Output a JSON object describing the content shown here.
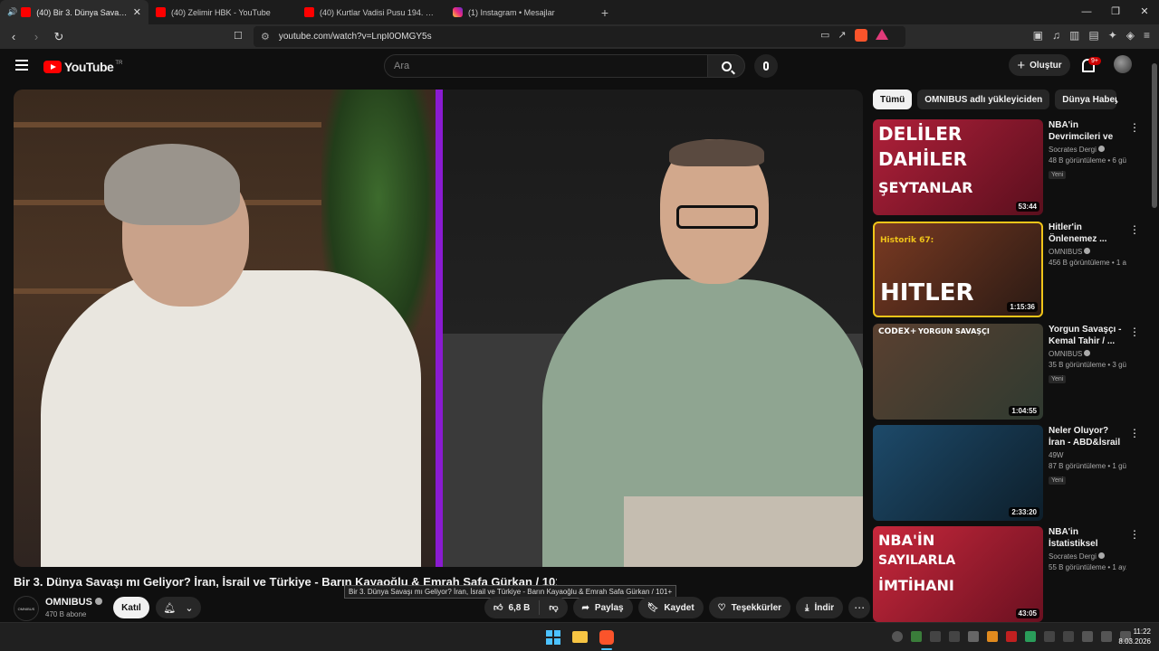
{
  "browser": {
    "tabs": [
      {
        "title": "(40) Bir 3. Dünya Savaşı mı Geliyor?",
        "icon": "youtube-icon",
        "active": true
      },
      {
        "title": "(40) Zelimir HBK - YouTube",
        "icon": "youtube-icon",
        "active": false
      },
      {
        "title": "(40) Kurtlar Vadisi Pusu 194. Bölüm -",
        "icon": "youtube-icon",
        "active": false
      },
      {
        "title": "(1) Instagram • Mesajlar",
        "icon": "instagram-icon",
        "active": false
      }
    ],
    "new_tab": "+",
    "url": "youtube.com/watch?v=LnpI0OMGY5s",
    "window_controls": {
      "minimize": "—",
      "restore": "❐",
      "close": "✕"
    }
  },
  "header": {
    "logo_text": "YouTube",
    "country": "TR",
    "search_placeholder": "Ara",
    "create_label": "Oluştur",
    "notifications_badge": "9+"
  },
  "video": {
    "title": "Bir 3. Dünya Savaşı mı Geliyor? İran, İsrail ve Türkiye - Barın Kayaoğlu & Emrah Safa Gürkan / 101+",
    "tooltip": "Bir 3. Dünya Savaşı mı Geliyor? İran, İsrail ve Türkiye - Barın Kayaoğlu & Emrah Safa Gürkan / 101+",
    "channel": {
      "avatar_text": "OMNIBUS",
      "name": "OMNIBUS",
      "subscribers": "470 B abone",
      "join_label": "Katıl"
    },
    "actions": {
      "likes": "6,8 B",
      "share": "Paylaş",
      "save": "Kaydet",
      "thanks": "Teşekkürler",
      "download": "İndir"
    }
  },
  "chips": [
    {
      "label": "Tümü",
      "active": true
    },
    {
      "label": "OMNIBUS adlı yükleyiciden",
      "active": false
    },
    {
      "label": "Dünya Haberleri",
      "active": false
    }
  ],
  "recommendations": [
    {
      "title": "NBA'in Devrimcileri ve İmza ...",
      "channel": "Socrates Dergi",
      "meta": "48 B görüntüleme • 6 gün...",
      "new": "Yeni",
      "duration": "53:44",
      "thumb_text_1": "DELİLER",
      "thumb_text_2": "DAHİLER",
      "thumb_text_3": "ŞEYTANLAR"
    },
    {
      "title": "Hitler'in Önlenemez ...",
      "channel": "OMNIBUS",
      "meta": "456 B görüntüleme • 1 ay...",
      "new": "",
      "duration": "1:15:36",
      "thumb_text_1": "Historik 67:",
      "thumb_text_2": "HITLER",
      "thumb_text_3": ""
    },
    {
      "title": "Yorgun Savaşçı - Kemal Tahir / ...",
      "channel": "OMNIBUS",
      "meta": "35 B görüntüleme • 3 gün...",
      "new": "Yeni",
      "duration": "1:04:55",
      "thumb_text_1": "CODEX+",
      "thumb_text_2": "YORGUN SAVAŞÇI",
      "thumb_text_3": ""
    },
    {
      "title": "Neler Oluyor? İran - ABD&İsrail ...",
      "channel": "49W",
      "meta": "87 B görüntüleme • 1 gün...",
      "new": "Yeni",
      "duration": "2:33:20",
      "thumb_text_1": "",
      "thumb_text_2": "",
      "thumb_text_3": ""
    },
    {
      "title": "NBA'in İstatistiksel Tarihi: Box Score,...",
      "channel": "Socrates Dergi",
      "meta": "55 B görüntüleme • 1 ay...",
      "new": "",
      "duration": "43:05",
      "thumb_text_1": "NBA'İN",
      "thumb_text_2": "SAYILARLA",
      "thumb_text_3": "İMTİHANI"
    }
  ],
  "taskbar": {
    "time": "11:22",
    "date": "8.03.2026"
  },
  "colors": {
    "bg": "#0f0f0f",
    "accent": "#ff0000",
    "purple_divider": "#8a1bd1"
  }
}
